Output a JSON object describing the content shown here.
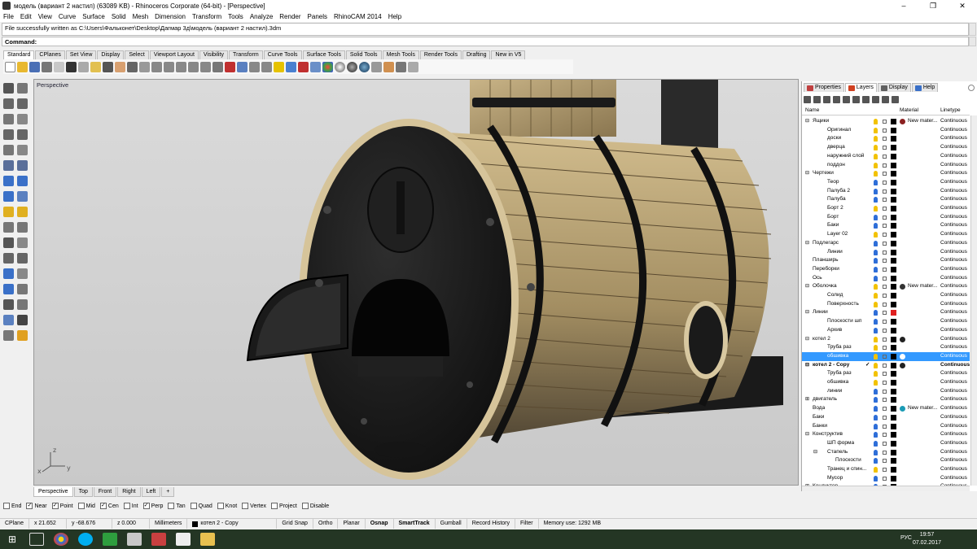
{
  "window": {
    "title": "модель (вариант 2 настил) (63089 KB) - Rhinoceros Corporate (64-bit) - [Perspective]",
    "minimize": "–",
    "maximize": "❐",
    "close": "✕"
  },
  "menu": [
    "File",
    "Edit",
    "View",
    "Curve",
    "Surface",
    "Solid",
    "Mesh",
    "Dimension",
    "Transform",
    "Tools",
    "Analyze",
    "Render",
    "Panels",
    "RhinoCAM 2014",
    "Help"
  ],
  "command": {
    "history": "File successfully written as C:\\Users\\Фальконет\\Desktop\\Дагмар 3д\\модель (вариант 2 настил).3dm",
    "prompt": "Command:"
  },
  "toolbar_tabs": [
    "Standard",
    "CPlanes",
    "Set View",
    "Display",
    "Select",
    "Viewport Layout",
    "Visibility",
    "Transform",
    "Curve Tools",
    "Surface Tools",
    "Solid Tools",
    "Mesh Tools",
    "Render Tools",
    "Drafting",
    "New in V5"
  ],
  "viewport": {
    "title": "Perspective",
    "axis_x": "x",
    "axis_y": "y",
    "axis_z": "z"
  },
  "view_tabs": [
    "Perspective",
    "Top",
    "Front",
    "Right",
    "Left",
    "+"
  ],
  "osnaps": [
    {
      "label": "End",
      "checked": false
    },
    {
      "label": "Near",
      "checked": true
    },
    {
      "label": "Point",
      "checked": true
    },
    {
      "label": "Mid",
      "checked": false
    },
    {
      "label": "Cen",
      "checked": true
    },
    {
      "label": "Int",
      "checked": false
    },
    {
      "label": "Perp",
      "checked": true
    },
    {
      "label": "Tan",
      "checked": false
    },
    {
      "label": "Quad",
      "checked": false
    },
    {
      "label": "Knot",
      "checked": false
    },
    {
      "label": "Vertex",
      "checked": false
    },
    {
      "label": "Project",
      "checked": false
    },
    {
      "label": "Disable",
      "checked": false
    }
  ],
  "status": {
    "cplane": "CPlane",
    "x": "x 21.652",
    "y": "y -68.676",
    "z": "z 0.000",
    "units": "Millimeters",
    "layer": "котел 2 - Copy",
    "grid_snap": "Grid Snap",
    "ortho": "Ortho",
    "planar": "Planar",
    "osnap": "Osnap",
    "smarttrack": "SmartTrack",
    "gumball": "Gumball",
    "record_history": "Record History",
    "filter": "Filter",
    "memory": "Memory use: 1292 MB"
  },
  "panel": {
    "tabs": [
      "Properties",
      "Layers",
      "Display",
      "Help"
    ],
    "columns": {
      "name": "Name",
      "material": "Material",
      "linetype": "Linetype"
    },
    "layers": [
      {
        "name": "Ящики",
        "level": 0,
        "expander": "⊟",
        "bulb": "yellow",
        "color": "#000000",
        "mat": "#8b2020",
        "mat_label": "New mater...",
        "linetype": "Continuous"
      },
      {
        "name": "Оригинал",
        "level": 1,
        "bulb": "yellow",
        "color": "#000000",
        "linetype": "Continuous"
      },
      {
        "name": "доски",
        "level": 1,
        "bulb": "yellow",
        "color": "#000000",
        "linetype": "Continuous"
      },
      {
        "name": "дверца",
        "level": 1,
        "bulb": "yellow",
        "color": "#000000",
        "linetype": "Continuous"
      },
      {
        "name": "наружний слой",
        "level": 1,
        "bulb": "yellow",
        "color": "#000000",
        "linetype": "Continuous"
      },
      {
        "name": "поддон",
        "level": 1,
        "bulb": "yellow",
        "color": "#000000",
        "linetype": "Continuous"
      },
      {
        "name": "Чертежи",
        "level": 0,
        "expander": "⊟",
        "bulb": "yellow",
        "color": "#000000",
        "linetype": "Continuous"
      },
      {
        "name": "Теор",
        "level": 1,
        "bulb": "blue",
        "color": "#000000",
        "linetype": "Continuous"
      },
      {
        "name": "Палуба 2",
        "level": 1,
        "bulb": "blue",
        "color": "#000000",
        "linetype": "Continuous"
      },
      {
        "name": "Палуба",
        "level": 1,
        "bulb": "blue",
        "color": "#000000",
        "linetype": "Continuous"
      },
      {
        "name": "Борт 2",
        "level": 1,
        "bulb": "yellow",
        "color": "#000000",
        "linetype": "Continuous"
      },
      {
        "name": "Борт",
        "level": 1,
        "bulb": "blue",
        "color": "#000000",
        "linetype": "Continuous"
      },
      {
        "name": "Баки",
        "level": 1,
        "bulb": "blue",
        "color": "#000000",
        "linetype": "Continuous"
      },
      {
        "name": "Layer 02",
        "level": 1,
        "bulb": "yellow",
        "color": "#000000",
        "linetype": "Continuous"
      },
      {
        "name": "Подлегарс",
        "level": 0,
        "expander": "⊟",
        "bulb": "blue",
        "color": "#000000",
        "linetype": "Continuous"
      },
      {
        "name": "Линии",
        "level": 1,
        "bulb": "blue",
        "color": "#000000",
        "linetype": "Continuous"
      },
      {
        "name": "Планширь",
        "level": 0,
        "bulb": "blue",
        "color": "#000000",
        "linetype": "Continuous"
      },
      {
        "name": "Переборки",
        "level": 0,
        "bulb": "blue",
        "color": "#000000",
        "linetype": "Continuous"
      },
      {
        "name": "Ось",
        "level": 0,
        "bulb": "blue",
        "color": "#000000",
        "linetype": "Continuous"
      },
      {
        "name": "Оболочка",
        "level": 0,
        "expander": "⊟",
        "bulb": "yellow",
        "color": "#000000",
        "mat": "#333333",
        "mat_label": "New mater...",
        "linetype": "Continuous"
      },
      {
        "name": "Солид",
        "level": 1,
        "bulb": "yellow",
        "color": "#000000",
        "linetype": "Continuous"
      },
      {
        "name": "Поверхность",
        "level": 1,
        "bulb": "yellow",
        "color": "#000000",
        "linetype": "Continuous"
      },
      {
        "name": "Линии",
        "level": 0,
        "expander": "⊟",
        "bulb": "blue",
        "color": "#e02020",
        "linetype": "Continuous"
      },
      {
        "name": "Плоскости шп",
        "level": 1,
        "bulb": "blue",
        "color": "#000000",
        "linetype": "Continuous"
      },
      {
        "name": "Архив",
        "level": 1,
        "bulb": "blue",
        "color": "#000000",
        "linetype": "Continuous"
      },
      {
        "name": "котел 2",
        "level": 0,
        "expander": "⊟",
        "bulb": "yellow",
        "color": "#000000",
        "mat": "#222222",
        "linetype": "Continuous"
      },
      {
        "name": "Труба раз",
        "level": 1,
        "bulb": "yellow",
        "color": "#000000",
        "linetype": "Continuous"
      },
      {
        "name": "обшивка",
        "level": 1,
        "bulb": "yellow",
        "color": "#000000",
        "mat": "#ffffff",
        "linetype": "Continuous",
        "selected": true
      },
      {
        "name": "котел 2 - Copy",
        "level": 0,
        "expander": "⊟",
        "bulb": "yellow",
        "color": "#000000",
        "mat": "#222222",
        "linetype": "Continuous",
        "bold": true,
        "current": "✓"
      },
      {
        "name": "Труба раз",
        "level": 1,
        "bulb": "yellow",
        "color": "#000000",
        "linetype": "Continuous"
      },
      {
        "name": "обшивка",
        "level": 1,
        "bulb": "yellow",
        "color": "#000000",
        "linetype": "Continuous"
      },
      {
        "name": "линии",
        "level": 1,
        "bulb": "blue",
        "color": "#000000",
        "linetype": "Continuous"
      },
      {
        "name": "двигатель",
        "level": 0,
        "expander": "⊞",
        "bulb": "blue",
        "color": "#000000",
        "linetype": "Continuous"
      },
      {
        "name": "Вода",
        "level": 0,
        "bulb": "blue",
        "color": "#000000",
        "mat": "#1b9bb5",
        "mat_label": "New mater...",
        "linetype": "Continuous"
      },
      {
        "name": "Баки",
        "level": 0,
        "bulb": "blue",
        "color": "#000000",
        "linetype": "Continuous"
      },
      {
        "name": "Банки",
        "level": 0,
        "bulb": "blue",
        "color": "#000000",
        "linetype": "Continuous"
      },
      {
        "name": "Конструктив",
        "level": 0,
        "expander": "⊟",
        "bulb": "blue",
        "color": "#000000",
        "linetype": "Continuous"
      },
      {
        "name": "ШП форма",
        "level": 1,
        "bulb": "blue",
        "color": "#000000",
        "linetype": "Continuous"
      },
      {
        "name": "Стапель",
        "level": 1,
        "expander": "⊟",
        "bulb": "blue",
        "color": "#000000",
        "linetype": "Continuous"
      },
      {
        "name": "Плоскости",
        "level": 2,
        "bulb": "blue",
        "color": "#000000",
        "linetype": "Continuous"
      },
      {
        "name": "Транец и спин...",
        "level": 1,
        "bulb": "yellow",
        "color": "#000000",
        "linetype": "Continuous"
      },
      {
        "name": "Мусор",
        "level": 1,
        "bulb": "blue",
        "color": "#000000",
        "linetype": "Continuous"
      },
      {
        "name": "Кондуктор",
        "level": 0,
        "expander": "⊞",
        "bulb": "blue",
        "color": "#000000",
        "linetype": "Continuous"
      }
    ]
  },
  "taskbar": {
    "language": "РУС",
    "time": "19:57",
    "date": "07.02.2017"
  }
}
